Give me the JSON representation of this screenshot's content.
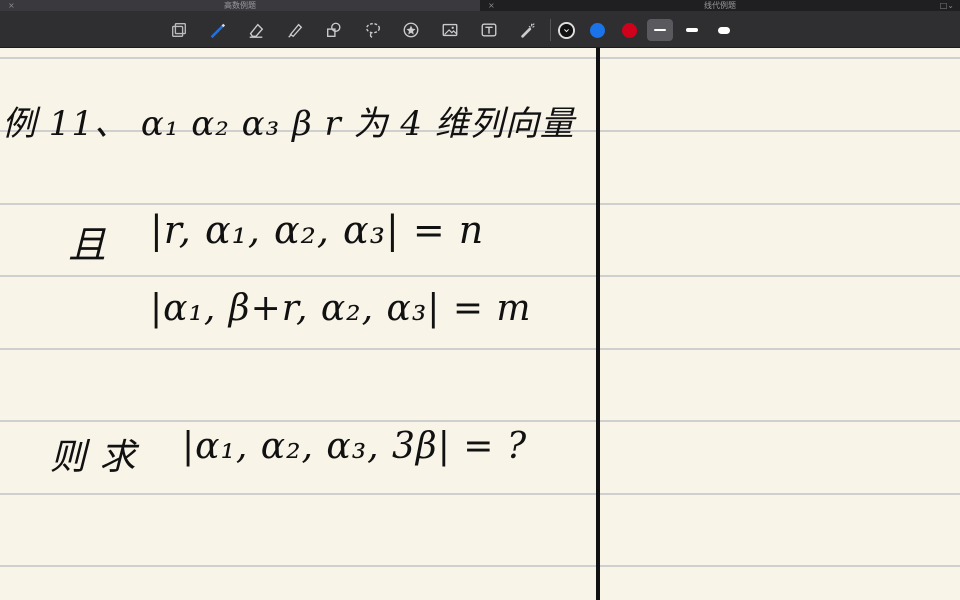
{
  "tabs": [
    {
      "close": "×",
      "title": "高数例题"
    },
    {
      "close": "×",
      "title": "线代例题",
      "extra": "□⌄"
    }
  ],
  "toolbar": {
    "tools": [
      "lasso-copy",
      "pen",
      "eraser",
      "highlighter",
      "shapes",
      "lasso",
      "stamp",
      "image",
      "text",
      "laser"
    ],
    "colors": [
      "#111111",
      "#1a73e8",
      "#d0021b"
    ],
    "stroke_widths": [
      "thin",
      "medium",
      "thick"
    ],
    "selected_width": "thin"
  },
  "note": {
    "line1": "例 11、 α₁ α₂ α₃ β r 为 4 维列向量",
    "line2_label": "且",
    "line2_expr": "|r, α₁, α₂, α₃| = n",
    "line3_expr": "|α₁, β+r, α₂, α₃| = m",
    "line4_label": "则 求",
    "line4_expr": "|α₁, α₂, α₃, 3β| = ?"
  }
}
